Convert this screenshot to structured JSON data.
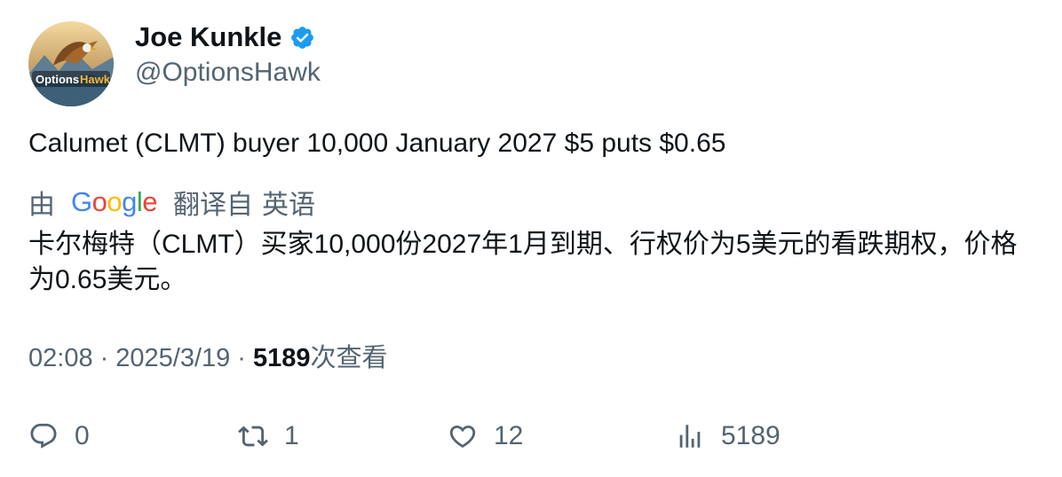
{
  "author": {
    "display_name": "Joe Kunkle",
    "handle": "@OptionsHawk",
    "avatar_text": "OptionsHawk",
    "verified": true
  },
  "tweet": {
    "text": "Calumet (CLMT) buyer 10,000 January 2027 $5 puts $0.65"
  },
  "translation": {
    "by_label": "由",
    "provider": "Google",
    "translated_from_label": "翻译自",
    "source_language": "英语",
    "translated_text": "卡尔梅特（CLMT）买家10,000份2027年1月到期、行权价为5美元的看跌期权，价格为0.65美元。"
  },
  "meta": {
    "time": "02:08",
    "date": "2025/3/19",
    "views_count": "5189",
    "views_label": "次查看",
    "separator": "·"
  },
  "actions": {
    "reply_count": "0",
    "retweet_count": "1",
    "like_count": "12",
    "views_count": "5189"
  },
  "colors": {
    "text": "#0f1419",
    "secondary": "#536471",
    "verified": "#1d9bf0",
    "google_blue": "#4285f4",
    "google_red": "#ea4335",
    "google_yellow": "#fbbc05",
    "google_green": "#34a853"
  },
  "icons": {
    "verified": "verified-badge-icon",
    "reply": "reply-icon",
    "retweet": "retweet-icon",
    "like": "heart-icon",
    "views": "views-chart-icon"
  }
}
